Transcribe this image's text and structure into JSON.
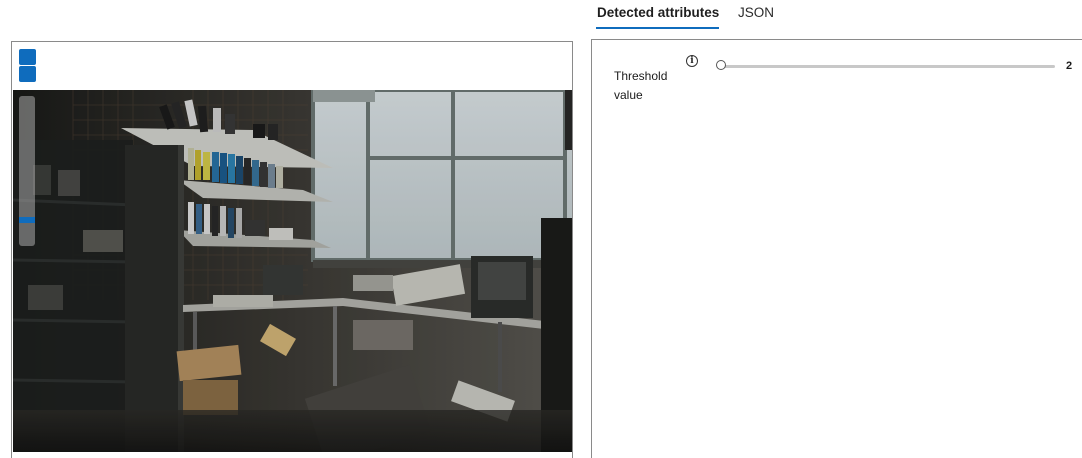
{
  "tabs": [
    {
      "label": "Detected attributes",
      "active": true
    },
    {
      "label": "JSON",
      "active": false
    }
  ],
  "image_viewer": {
    "toolbar_buttons": [
      "zoom-in",
      "zoom-out"
    ],
    "zoom_level": 0.16
  },
  "attributes": {
    "threshold": {
      "label": "Threshold value",
      "value": "2",
      "slider_fraction": 0.0,
      "info_icon_glyph": "i"
    }
  },
  "colors": {
    "accent": "#0f6cbd",
    "border": "#8a8a8a",
    "track": "#c8c8c8"
  }
}
